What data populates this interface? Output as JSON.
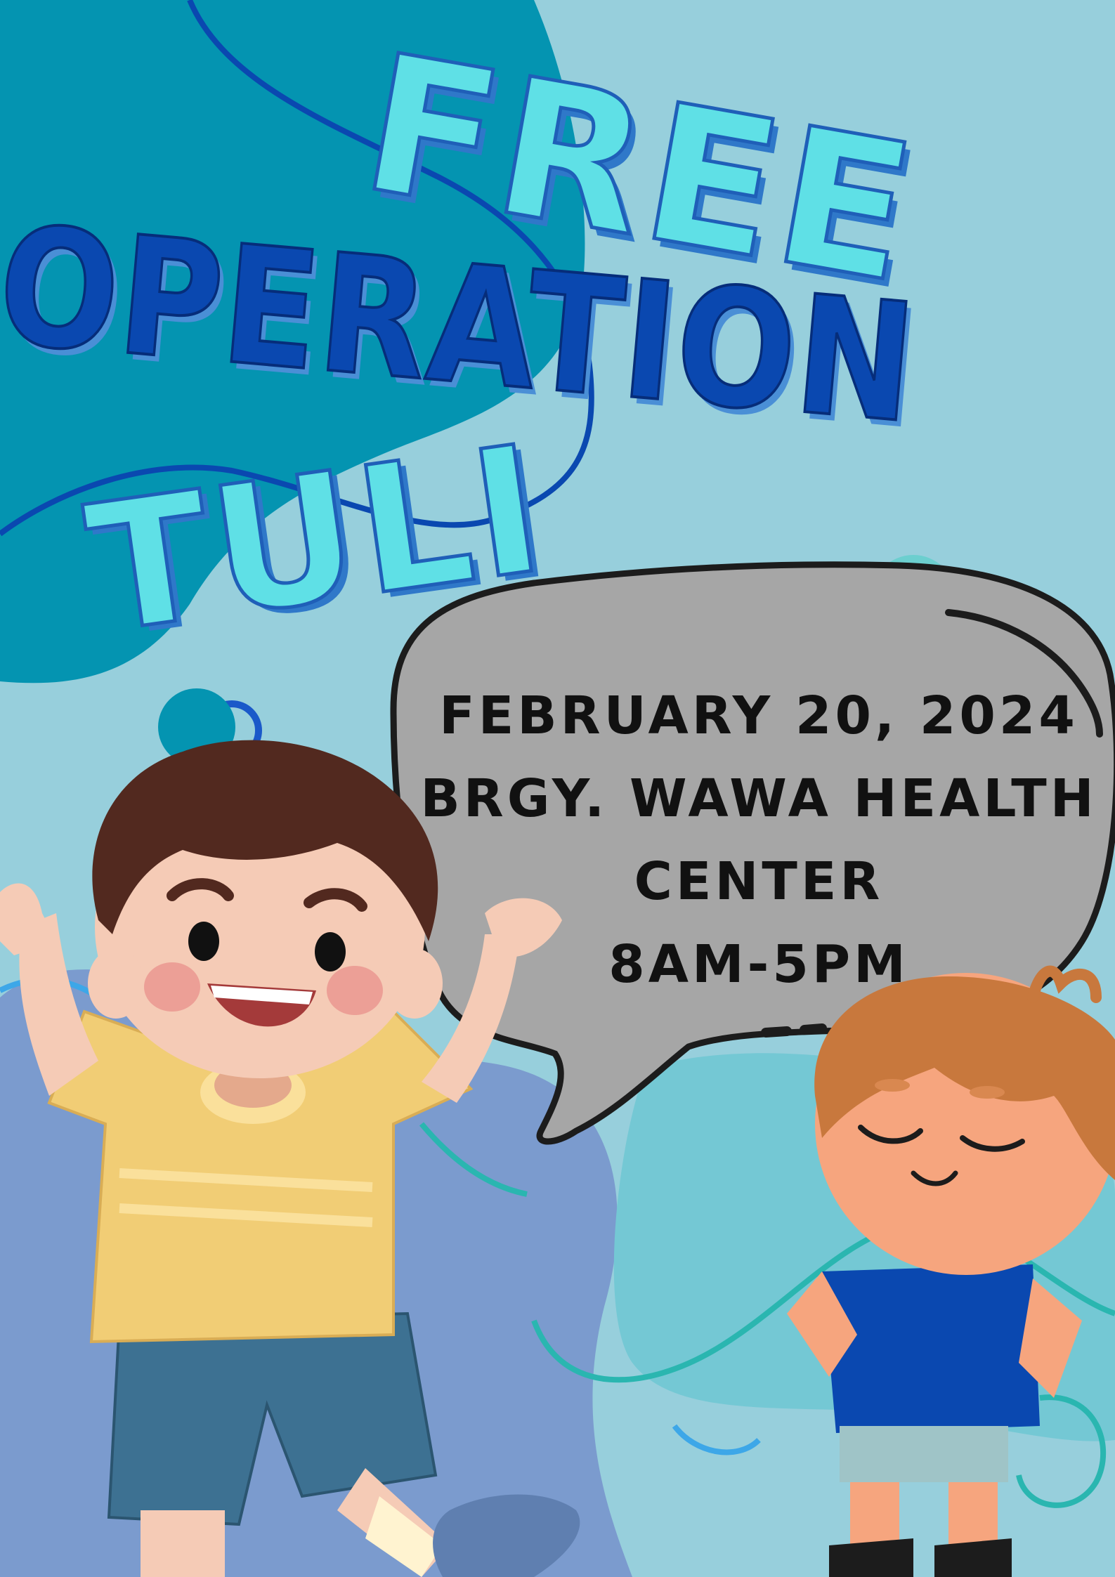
{
  "poster": {
    "title": {
      "line1": "FREE",
      "line2": "OPERATION",
      "line3": "TULI"
    },
    "details": {
      "date": "FEBRUARY 20, 2024",
      "venue_line1": "BRGY. WAWA HEALTH",
      "venue_line2": "CENTER",
      "time": "8AM-5PM"
    }
  },
  "colors": {
    "background": "#97cfdc",
    "light_title": "#5fe0e6",
    "dark_title": "#0a48b0",
    "bubble": "#a6a6a6",
    "text": "#111111"
  },
  "illustrations": [
    "happy-boy-yellow-shirt",
    "calm-boy-blue-shirt",
    "speech-bubble"
  ]
}
